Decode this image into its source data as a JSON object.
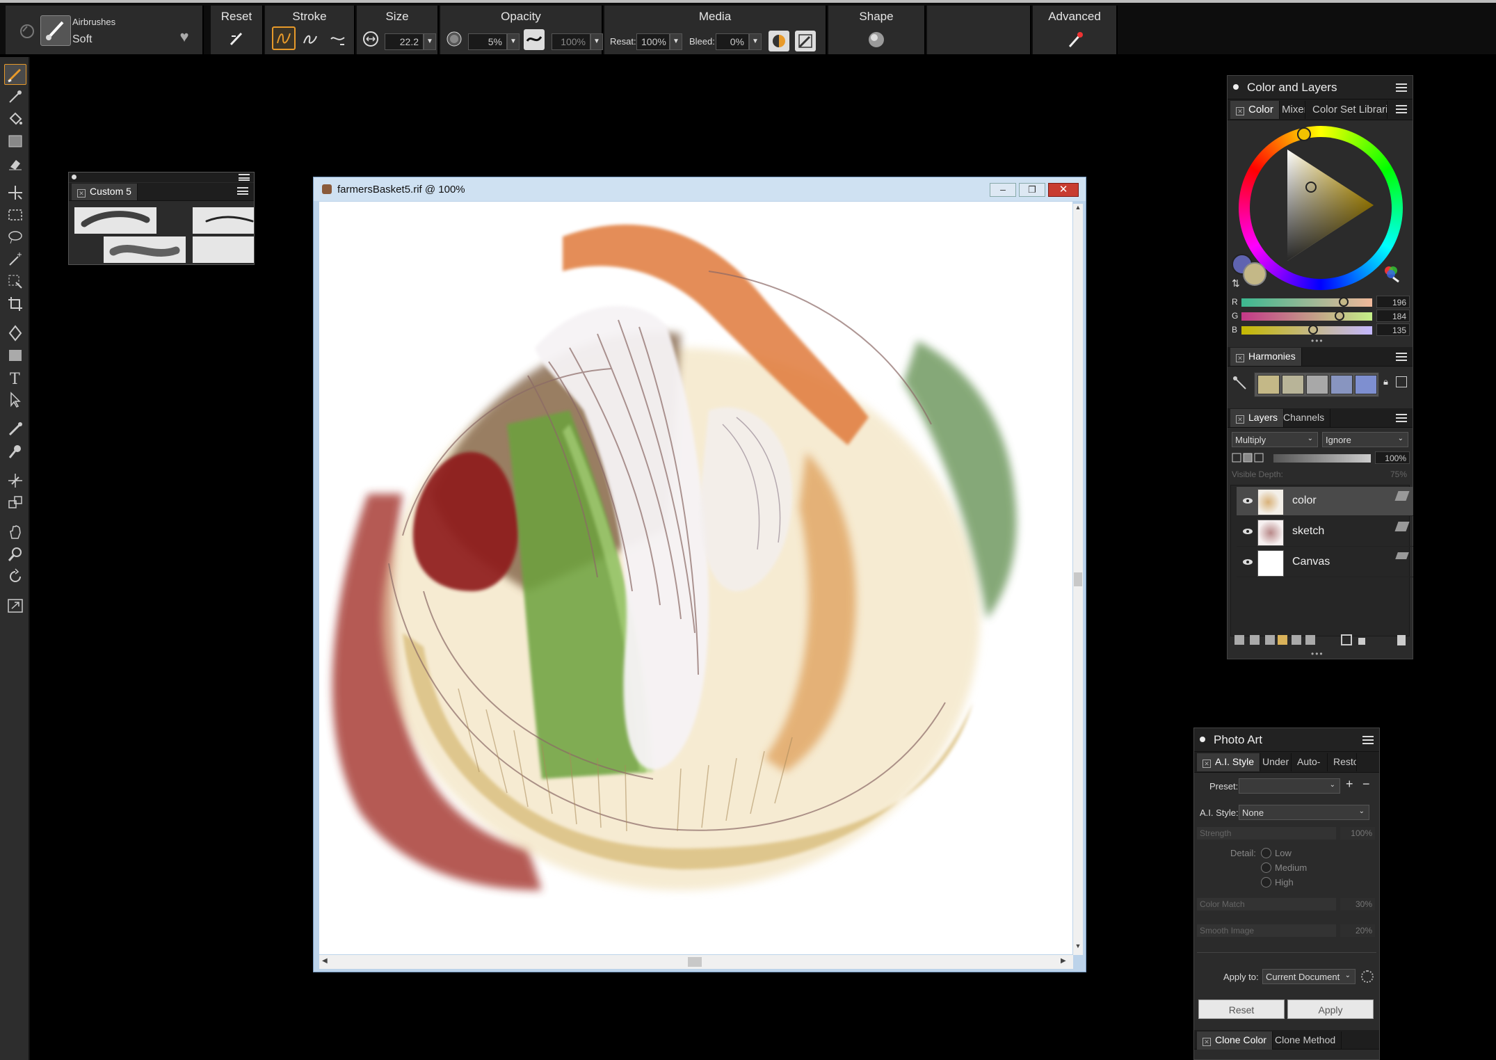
{
  "propbar": {
    "brush_category": "Airbrushes",
    "brush_variant": "Soft",
    "groups": {
      "reset": "Reset",
      "stroke": "Stroke",
      "size": "Size",
      "opacity": "Opacity",
      "media": "Media",
      "shape": "Shape",
      "advanced": "Advanced"
    },
    "size_value": "22.2",
    "opacity_value": "5%",
    "grain_value": "100%",
    "resat_label": "Resat:",
    "resat_value": "100%",
    "bleed_label": "Bleed:",
    "bleed_value": "0%"
  },
  "brush_panel": {
    "title": "Custom 5"
  },
  "document": {
    "title": "farmersBasket5.rif @ 100%"
  },
  "color_layers": {
    "title": "Color and Layers",
    "tabs": [
      "Color",
      "Mixer",
      "Color Set Librarie"
    ],
    "rgb": {
      "r_label": "R",
      "r_value": "196",
      "g_label": "G",
      "g_value": "184",
      "b_label": "B",
      "b_value": "135"
    },
    "main_color": "#c4b887",
    "harmonies_title": "Harmonies",
    "harmony_swatches": [
      "#c4b887",
      "#b8b498",
      "#a8a8a8",
      "#8895c0",
      "#7e8fd0"
    ],
    "layers_tabs": [
      "Layers",
      "Channels"
    ],
    "composite_method": "Multiply",
    "composite_depth": "Ignore",
    "opacity_value": "100%",
    "visible_depth_label": "Visible Depth:",
    "visible_depth_value": "75%",
    "layers": [
      {
        "name": "color"
      },
      {
        "name": "sketch"
      },
      {
        "name": "Canvas"
      }
    ]
  },
  "photo_art": {
    "title": "Photo Art",
    "tabs": [
      "A.I. Style",
      "Under",
      "Auto-",
      "Resto"
    ],
    "preset_label": "Preset:",
    "preset_value": "",
    "ai_style_label": "A.I. Style:",
    "ai_style_value": "None",
    "strength_label": "Strength",
    "strength_value": "100%",
    "detail_label": "Detail:",
    "detail_options": [
      "Low",
      "Medium",
      "High"
    ],
    "color_match_label": "Color Match",
    "color_match_value": "30%",
    "smooth_label": "Smooth Image",
    "smooth_value": "20%",
    "apply_to_label": "Apply to:",
    "apply_to_value": "Current Document",
    "reset_label": "Reset",
    "apply_label": "Apply",
    "bottom_tabs": [
      "Clone Color",
      "Clone Method"
    ]
  }
}
